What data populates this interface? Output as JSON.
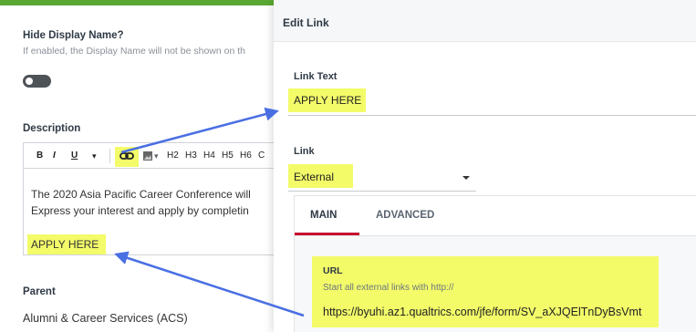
{
  "form": {
    "hide_display_name": {
      "label": "Hide Display Name?",
      "help": "If enabled, the Display Name will not be shown on th",
      "enabled": false
    },
    "description": {
      "label": "Description",
      "toolbar": {
        "bold": "B",
        "italic": "I",
        "underline": "U",
        "format_caret": "▾",
        "link_icon": "link-icon",
        "image_icon": "image-icon",
        "image_caret": "▾",
        "headings": [
          "H2",
          "H3",
          "H4",
          "H5",
          "H6",
          "C"
        ]
      },
      "lines": [
        "The 2020 Asia Pacific Career Conference will",
        "Express your interest and apply by completin"
      ],
      "link_text": "APPLY HERE"
    },
    "parent": {
      "label": "Parent",
      "value": "Alumni & Career Services (ACS)"
    }
  },
  "modal": {
    "title": "Edit Link",
    "link_text": {
      "label": "Link Text",
      "value": "APPLY HERE"
    },
    "link": {
      "label": "Link",
      "value": "External"
    },
    "tabs": [
      "MAIN",
      "ADVANCED"
    ],
    "active_tab": "MAIN",
    "url": {
      "label": "URL",
      "help": "Start all external links with http://",
      "value": "https://byuhi.az1.qualtrics.com/jfe/form/SV_aXJQElTnDyBsVmt"
    }
  },
  "colors": {
    "highlight": "#f3fb69",
    "arrow": "#4a6fe3",
    "accent_green": "#5aa833",
    "active_tab": "#c8102e"
  }
}
